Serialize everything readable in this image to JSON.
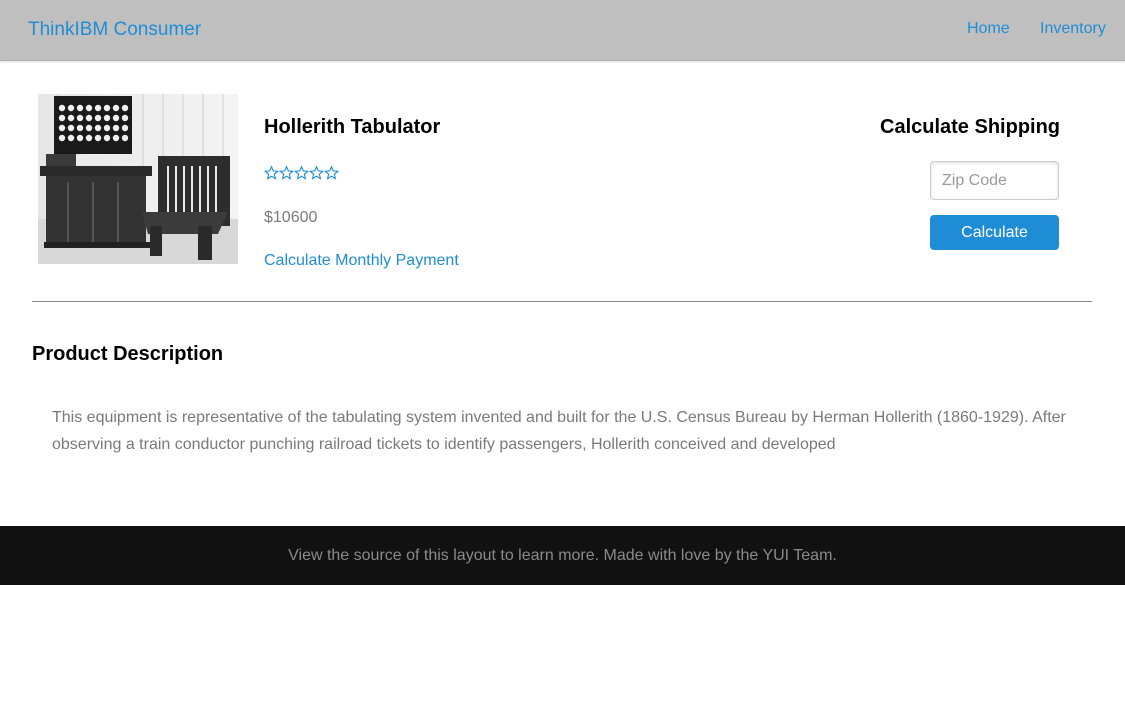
{
  "header": {
    "brand": "ThinkIBM Consumer",
    "nav": {
      "home": "Home",
      "inventory": "Inventory"
    }
  },
  "product": {
    "title": "Hollerith Tabulator",
    "rating": {
      "value": 0,
      "max": 5
    },
    "price": "$10600",
    "monthly_payment_link": "Calculate Monthly Payment",
    "image_alt": "Hollerith tabulating machine photo"
  },
  "shipping": {
    "title": "Calculate Shipping",
    "zip_placeholder": "Zip Code",
    "zip_value": "",
    "calculate_label": "Calculate"
  },
  "description": {
    "title": "Product Description",
    "text": "This equipment is representative of the tabulating system invented and built for the U.S. Census Bureau by Herman Hollerith (1860-1929). After observing a train conductor punching railroad tickets to identify passengers, Hollerith conceived and developed"
  },
  "footer": {
    "text": "View the source of this layout to learn more. Made with love by the YUI Team."
  },
  "colors": {
    "accent": "#1f8dd6",
    "topbar": "#bfbfbf",
    "footer": "#111111",
    "muted_text": "#7a7a7a"
  }
}
